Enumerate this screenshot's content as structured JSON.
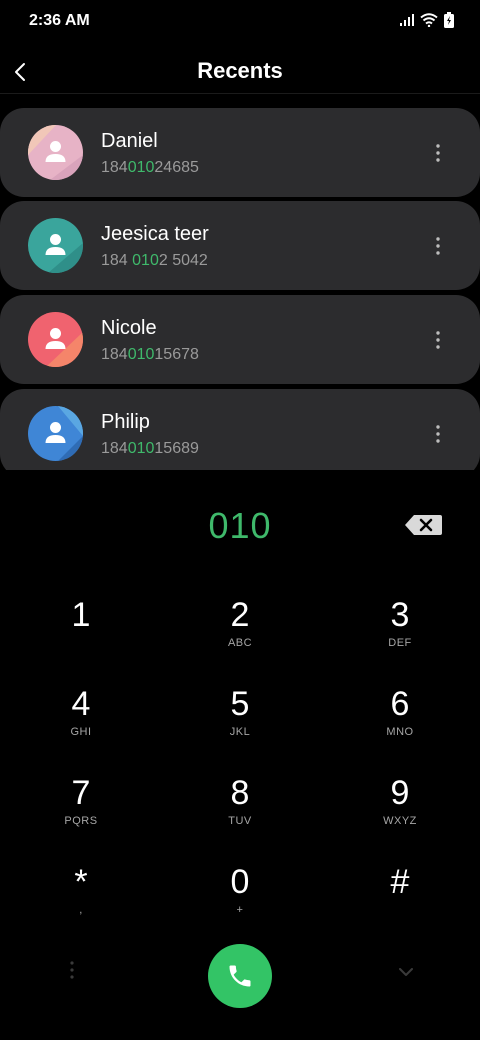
{
  "status_bar": {
    "time": "2:36 AM"
  },
  "header": {
    "title": "Recents"
  },
  "contacts": [
    {
      "name": "Daniel",
      "number_pre": "184",
      "number_match": "010",
      "number_post": "24685"
    },
    {
      "name": "Jeesica teer",
      "number_pre": "184 ",
      "number_match": "010",
      "number_post": "2 5042"
    },
    {
      "name": "Nicole",
      "number_pre": "184",
      "number_match": "010",
      "number_post": "15678"
    },
    {
      "name": "Philip",
      "number_pre": "184",
      "number_match": "010",
      "number_post": "15689"
    }
  ],
  "dialer": {
    "entered": "010"
  },
  "keypad": [
    {
      "digit": "1",
      "letters": ""
    },
    {
      "digit": "2",
      "letters": "ABC"
    },
    {
      "digit": "3",
      "letters": "DEF"
    },
    {
      "digit": "4",
      "letters": "GHI"
    },
    {
      "digit": "5",
      "letters": "JKL"
    },
    {
      "digit": "6",
      "letters": "MNO"
    },
    {
      "digit": "7",
      "letters": "PQRS"
    },
    {
      "digit": "8",
      "letters": "TUV"
    },
    {
      "digit": "9",
      "letters": "WXYZ"
    },
    {
      "digit": "*",
      "letters": ","
    },
    {
      "digit": "0",
      "letters": "+"
    },
    {
      "digit": "#",
      "letters": ""
    }
  ],
  "colors": {
    "accent_green": "#3fb96b",
    "call_button": "#33c466",
    "card_background": "#2c2c2e"
  },
  "icons": {
    "back": "chevron-left-icon",
    "more": "more-vertical-icon",
    "backspace": "backspace-icon",
    "call": "phone-icon",
    "menu": "more-vertical-icon",
    "collapse": "chevron-down-icon"
  }
}
